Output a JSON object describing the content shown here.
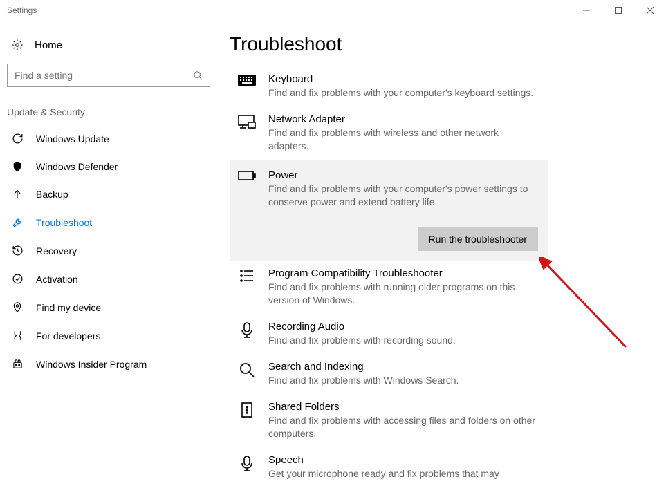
{
  "window": {
    "title": "Settings"
  },
  "sidebar": {
    "home_label": "Home",
    "search_placeholder": "Find a setting",
    "section_heading": "Update & Security",
    "items": [
      {
        "label": "Windows Update"
      },
      {
        "label": "Windows Defender"
      },
      {
        "label": "Backup"
      },
      {
        "label": "Troubleshoot"
      },
      {
        "label": "Recovery"
      },
      {
        "label": "Activation"
      },
      {
        "label": "Find my device"
      },
      {
        "label": "For developers"
      },
      {
        "label": "Windows Insider Program"
      }
    ]
  },
  "content": {
    "heading": "Troubleshoot",
    "items": [
      {
        "title": "Keyboard",
        "desc": "Find and fix problems with your computer's keyboard settings."
      },
      {
        "title": "Network Adapter",
        "desc": "Find and fix problems with wireless and other network adapters."
      },
      {
        "title": "Power",
        "desc": "Find and fix problems with your computer's power settings to conserve power and extend battery life."
      },
      {
        "title": "Program Compatibility Troubleshooter",
        "desc": "Find and fix problems with running older programs on this version of Windows."
      },
      {
        "title": "Recording Audio",
        "desc": "Find and fix problems with recording sound."
      },
      {
        "title": "Search and Indexing",
        "desc": "Find and fix problems with Windows Search."
      },
      {
        "title": "Shared Folders",
        "desc": "Find and fix problems with accessing files and folders on other computers."
      },
      {
        "title": "Speech",
        "desc": "Get your microphone ready and fix problems that may"
      }
    ],
    "run_button": "Run the troubleshooter"
  }
}
